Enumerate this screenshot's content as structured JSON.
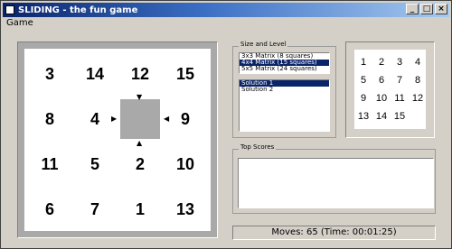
{
  "window": {
    "title": "SLIDING - the fun game",
    "minimize_label": "_",
    "maximize_label": "□",
    "close_label": "×"
  },
  "menu": {
    "items": [
      {
        "label": "Game"
      }
    ]
  },
  "board": {
    "tiles": [
      "3",
      "14",
      "12",
      "15",
      "8",
      "4",
      "",
      "9",
      "11",
      "5",
      "2",
      "10",
      "6",
      "7",
      "1",
      "13"
    ]
  },
  "size_level": {
    "title": "Size and Level",
    "options": [
      {
        "label": "3x3 Matrix (8 squares)",
        "selected": false
      },
      {
        "label": "4x4 Matrix (15 squares)",
        "selected": true
      },
      {
        "label": "5x5 Matrix (24 squares)",
        "selected": false
      }
    ],
    "solutions": [
      {
        "label": "Solution 1",
        "selected": true
      },
      {
        "label": "Solution 2",
        "selected": false
      }
    ]
  },
  "solution_preview": {
    "cells": [
      "1",
      "2",
      "3",
      "4",
      "5",
      "6",
      "7",
      "8",
      "9",
      "10",
      "11",
      "12",
      "13",
      "14",
      "15",
      ""
    ]
  },
  "top_scores": {
    "title": "Top Scores"
  },
  "status": {
    "text": "Moves: 65  (Time: 00:01:25)"
  }
}
